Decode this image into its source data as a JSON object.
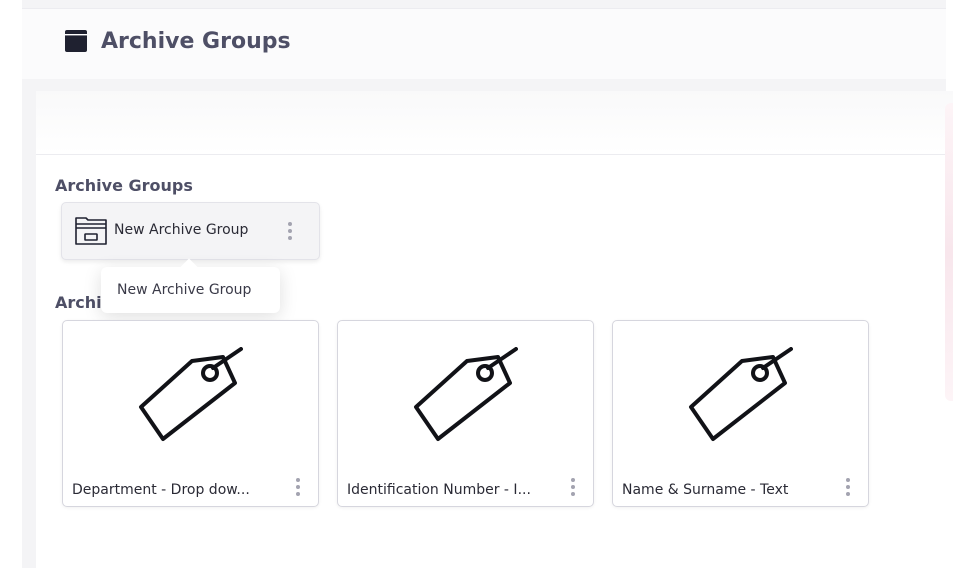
{
  "header": {
    "title": "Archive Groups",
    "icon": "archive-box-icon"
  },
  "groups_section": {
    "title": "Archive Groups",
    "groups": [
      {
        "label": "New Archive Group",
        "icon": "archive-folder-icon"
      }
    ]
  },
  "tooltip": {
    "text": "New Archive Group"
  },
  "fields_section": {
    "title": "Archi"
  },
  "cards": [
    {
      "label": "Department - Drop dow...",
      "icon": "tag-icon"
    },
    {
      "label": "Identification Number - I...",
      "icon": "tag-icon"
    },
    {
      "label": "Name & Surname - Text",
      "icon": "tag-icon"
    }
  ],
  "colors": {
    "title": "#4e4f66",
    "text": "#2a2a35",
    "background": "#f4f4f6",
    "accent": "#f8e6ec"
  }
}
